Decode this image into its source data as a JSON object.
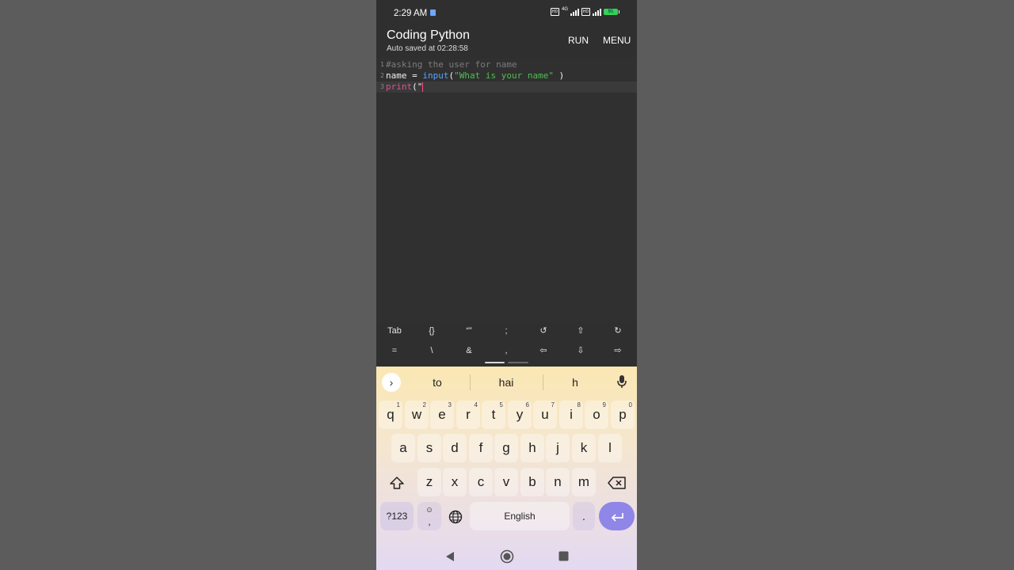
{
  "status": {
    "time": "2:29 AM",
    "battery": "91",
    "net": "4G"
  },
  "header": {
    "title": "Coding Python",
    "subtitle": "Auto saved at 02:28:58",
    "run_label": "RUN",
    "menu_label": "MENU"
  },
  "editor": {
    "lines": [
      {
        "num": "1",
        "comment": "#asking the user for name"
      },
      {
        "num": "2",
        "p1": "name = ",
        "func": "input",
        "p2": "(",
        "str": "\"What is your name\"",
        "p3": " )"
      },
      {
        "num": "3",
        "kw": "print",
        "p1": "(\""
      }
    ]
  },
  "extra_keys": {
    "row1": [
      "Tab",
      "{}",
      "“”",
      ";",
      "↺",
      "⇧",
      "↻"
    ],
    "row2": [
      "=",
      "\\",
      "&",
      ",",
      "⇦",
      "⇩",
      "⇨"
    ]
  },
  "keyboard": {
    "suggestions": [
      "to",
      "hai",
      "h"
    ],
    "row1": [
      [
        "q",
        "1"
      ],
      [
        "w",
        "2"
      ],
      [
        "e",
        "3"
      ],
      [
        "r",
        "4"
      ],
      [
        "t",
        "5"
      ],
      [
        "y",
        "6"
      ],
      [
        "u",
        "7"
      ],
      [
        "i",
        "8"
      ],
      [
        "o",
        "9"
      ],
      [
        "p",
        "0"
      ]
    ],
    "row2": [
      "a",
      "s",
      "d",
      "f",
      "g",
      "h",
      "j",
      "k",
      "l"
    ],
    "row3": [
      "z",
      "x",
      "c",
      "v",
      "b",
      "n",
      "m"
    ],
    "symbols_label": "?123",
    "comma_label": ",",
    "space_label": "English",
    "period_label": "."
  },
  "colors": {
    "editor_bg": "#303030",
    "keyboard_top": "#fbe7b3",
    "enter_key": "#8f86e8"
  }
}
